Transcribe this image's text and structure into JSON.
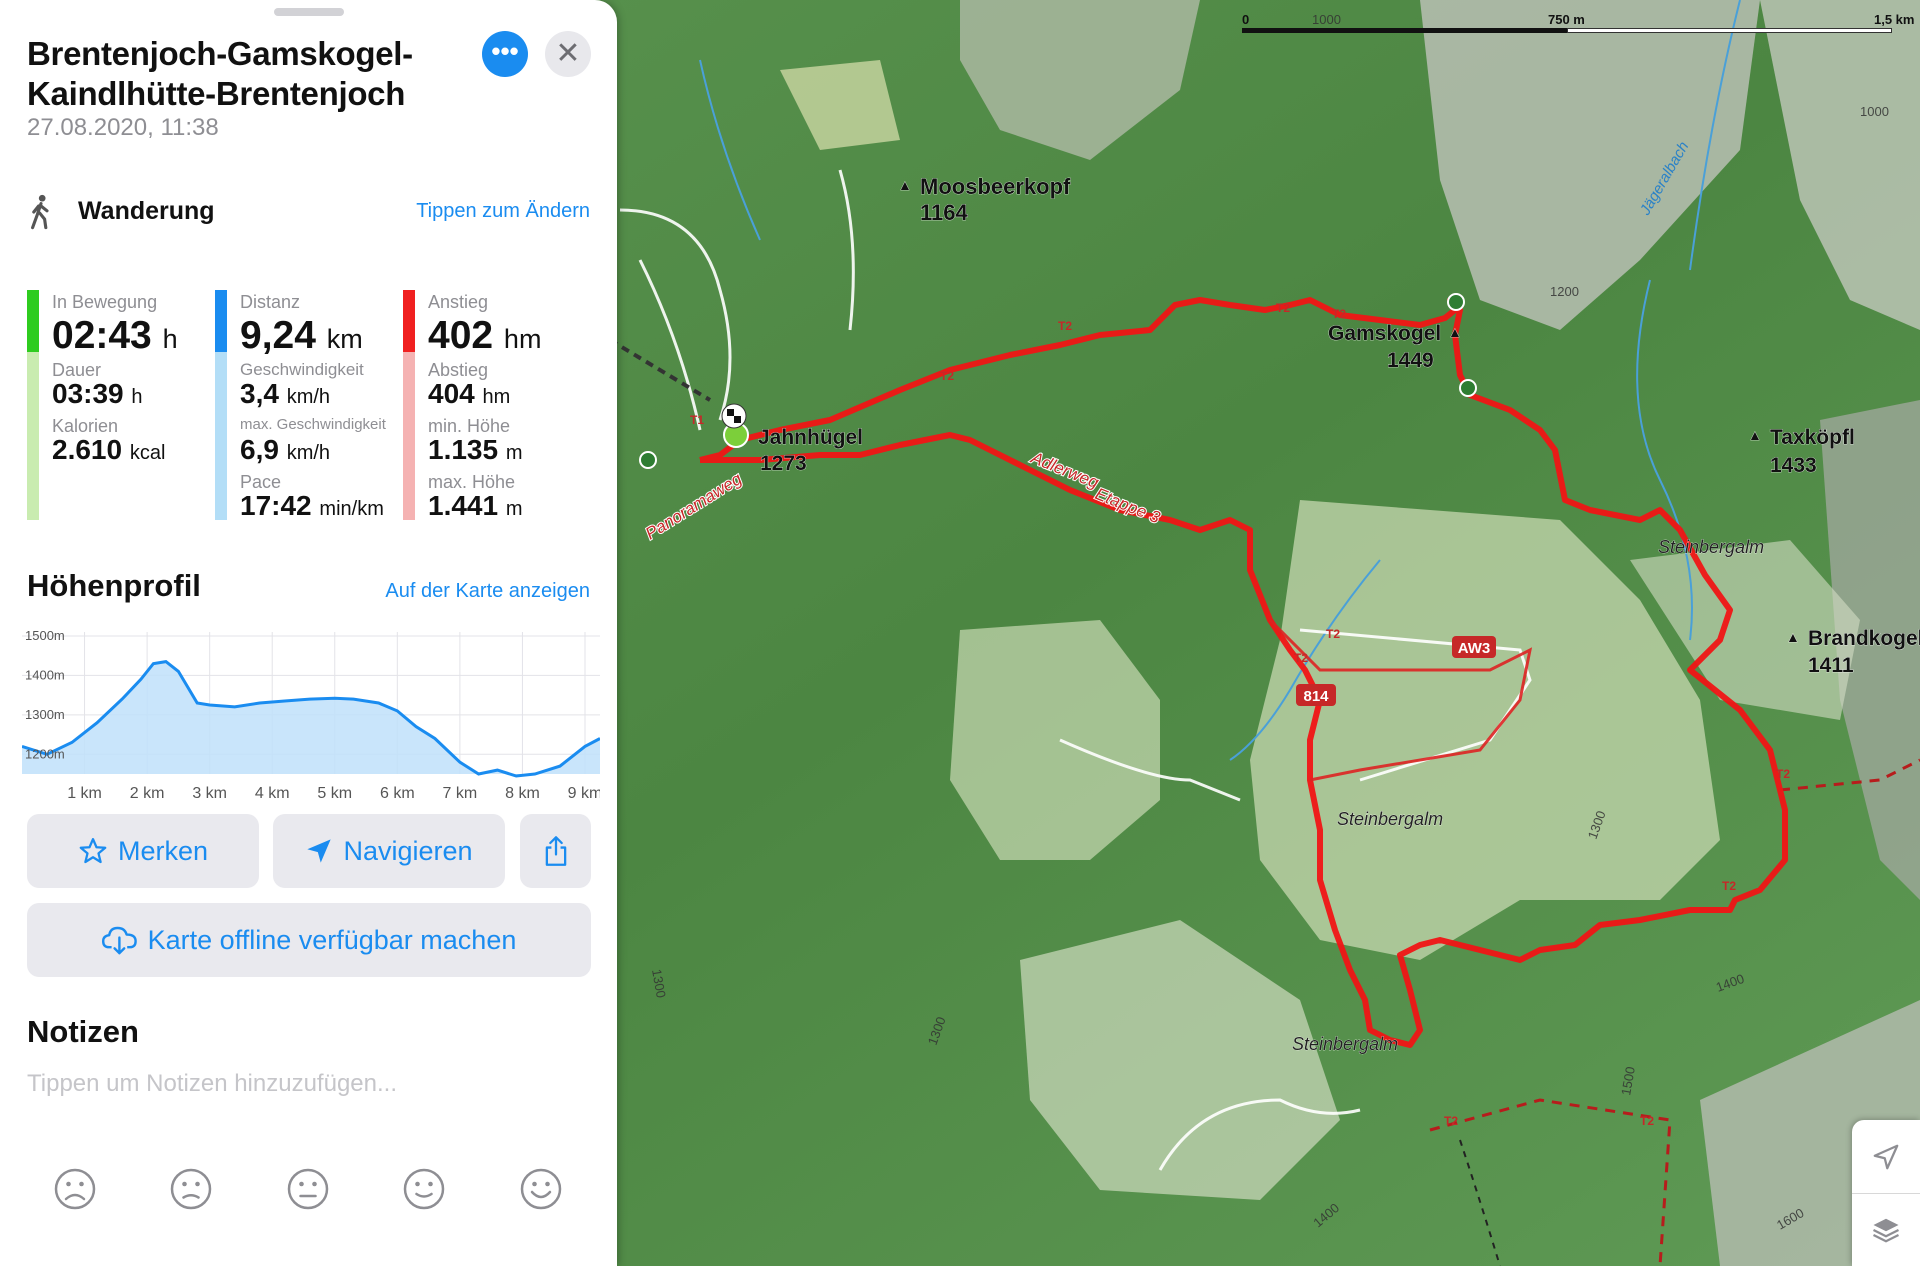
{
  "route": {
    "title": "Brentenjoch-Gamskogel-Kaindlhütte-Brentenjoch",
    "date": "27.08.2020, 11:38"
  },
  "activity": {
    "icon": "hiker-icon",
    "label": "Wanderung",
    "change_link": "Tippen zum Ändern"
  },
  "stats": {
    "time": {
      "color": "#2ecc1f",
      "color_light": "#c9ecb0",
      "moving_label": "In Bewegung",
      "moving_value": "02:43",
      "moving_unit": "h",
      "duration_label": "Dauer",
      "duration_value": "03:39",
      "duration_unit": "h",
      "calories_label": "Kalorien",
      "calories_value": "2.610",
      "calories_unit": "kcal"
    },
    "distance": {
      "color": "#1a8cf0",
      "color_light": "#b3def7",
      "distance_label": "Distanz",
      "distance_value": "9,24",
      "distance_unit": "km",
      "speed_label": "Geschwindigkeit",
      "speed_value": "3,4",
      "speed_unit": "km/h",
      "maxspeed_label": "max. Geschwindigkeit",
      "maxspeed_value": "6,9",
      "maxspeed_unit": "km/h",
      "pace_label": "Pace",
      "pace_value": "17:42",
      "pace_unit": "min/km"
    },
    "elevation": {
      "color": "#f02020",
      "color_light": "#f5b2b2",
      "ascent_label": "Anstieg",
      "ascent_value": "402",
      "ascent_unit": "hm",
      "descent_label": "Abstieg",
      "descent_value": "404",
      "descent_unit": "hm",
      "min_label": "min. Höhe",
      "min_value": "1.135",
      "min_unit": "m",
      "max_label": "max. Höhe",
      "max_value": "1.441",
      "max_unit": "m"
    }
  },
  "profile": {
    "title": "Höhenprofil",
    "map_link": "Auf der Karte anzeigen",
    "chart_data": {
      "type": "area",
      "xlabel": "",
      "ylabel": "",
      "x_ticks": [
        "1 km",
        "2 km",
        "3 km",
        "4 km",
        "5 km",
        "6 km",
        "7 km",
        "8 km",
        "9 km"
      ],
      "y_ticks": [
        "1500m",
        "1400m",
        "1300m",
        "1200m"
      ],
      "ylim": [
        1150,
        1510
      ],
      "xlim": [
        0,
        9.24
      ],
      "x": [
        0,
        0.4,
        0.8,
        1.2,
        1.6,
        1.9,
        2.1,
        2.3,
        2.5,
        2.8,
        3.0,
        3.4,
        3.8,
        4.2,
        4.6,
        5.0,
        5.3,
        5.7,
        6.0,
        6.3,
        6.6,
        7.0,
        7.3,
        7.6,
        7.9,
        8.2,
        8.6,
        9.0,
        9.24
      ],
      "values": [
        1220,
        1200,
        1230,
        1280,
        1340,
        1390,
        1430,
        1435,
        1410,
        1330,
        1325,
        1320,
        1330,
        1335,
        1340,
        1342,
        1340,
        1330,
        1310,
        1270,
        1240,
        1180,
        1150,
        1160,
        1145,
        1150,
        1170,
        1220,
        1240
      ],
      "color": "#1a8cf0",
      "fill_color": "#bfe0fa",
      "grid": true
    }
  },
  "buttons": {
    "save": {
      "label": "Merken",
      "icon": "star-icon"
    },
    "navigate": {
      "label": "Navigieren",
      "icon": "navigation-arrow-icon"
    },
    "share": {
      "icon": "share-icon"
    },
    "offline": {
      "label": "Karte offline verfügbar machen",
      "icon": "cloud-download-icon"
    }
  },
  "notes": {
    "title": "Notizen",
    "placeholder": "Tippen um Notizen hinzuzufügen...",
    "moods": [
      "very-sad-face-icon",
      "sad-face-icon",
      "neutral-face-icon",
      "happy-face-icon",
      "very-happy-face-icon"
    ]
  },
  "map": {
    "scale": {
      "start": "0",
      "mid": "750 m",
      "end": "1,5 km"
    },
    "peaks": [
      {
        "name": "Moosbeerkopf",
        "elevation": "1164"
      },
      {
        "name": "Gamskogel",
        "elevation": "1449"
      },
      {
        "name": "Jahnhügel",
        "elevation": "1273"
      },
      {
        "name": "Taxköpfl",
        "elevation": "1433"
      },
      {
        "name": "Brandkogel",
        "elevation": "1411"
      }
    ],
    "places": [
      "Steinbergalm",
      "Steinbergalm",
      "Steinbergalm"
    ],
    "trails": [
      "Panoramaweg",
      "Adlerweg",
      "Etappe 3",
      "Jägeralbach"
    ],
    "badges": [
      "AW3",
      "814"
    ],
    "contours": [
      "1000",
      "1000",
      "1200",
      "1300",
      "1300",
      "1400",
      "1500",
      "1600",
      "1400",
      "1300"
    ],
    "trail_marks": [
      "T2",
      "T2",
      "T2",
      "T2",
      "T2",
      "T2",
      "T2",
      "T2",
      "T2",
      "T2",
      "T1"
    ],
    "colors": {
      "route": "#f01515",
      "terrain": "#4f8a44"
    },
    "controls": [
      "location-arrow-icon",
      "layers-icon"
    ]
  }
}
